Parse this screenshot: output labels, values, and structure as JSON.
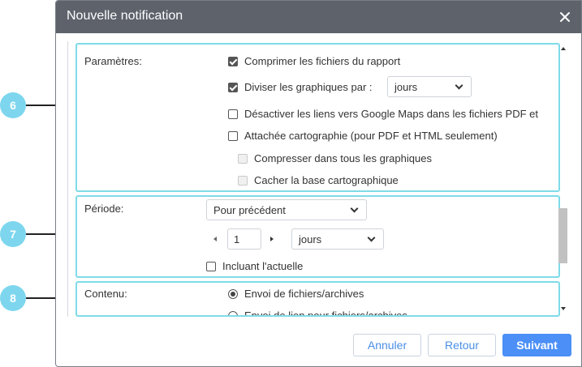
{
  "dialog": {
    "title": "Nouvelle notification",
    "close_icon": "close-icon"
  },
  "params": {
    "label": "Paramètres:",
    "compress": {
      "label": "Comprimer les fichiers du rapport",
      "checked": true
    },
    "split": {
      "label": "Diviser les graphiques par :",
      "checked": true,
      "select_value": "jours"
    },
    "disable_links": {
      "label": "Désactiver les liens vers Google Maps dans les fichiers PDF et",
      "checked": false
    },
    "attach_map": {
      "label": "Attachée cartographie (pour PDF et HTML seulement)",
      "checked": false
    },
    "compress_all": {
      "label": "Compresser dans tous les graphiques",
      "checked": false,
      "disabled": true
    },
    "hide_base": {
      "label": "Cacher la base cartographique",
      "checked": false,
      "disabled": true
    }
  },
  "period": {
    "label": "Période:",
    "type_value": "Pour précédent",
    "count": "1",
    "unit_value": "jours",
    "include_current": {
      "label": "Incluant l'actuelle",
      "checked": false
    }
  },
  "content": {
    "label": "Contenu:",
    "options": [
      {
        "label": "Envoi de fichiers/archives",
        "checked": true
      },
      {
        "label": "Envoi de lien pour fichiers/archives",
        "checked": false
      }
    ]
  },
  "callouts": [
    "6",
    "7",
    "8"
  ],
  "footer": {
    "cancel": "Annuler",
    "back": "Retour",
    "next": "Suivant"
  },
  "colors": {
    "header": "#5d626b",
    "section_border": "#7fdbe8",
    "callout": "#7dd6ee",
    "primary": "#4b8ff7"
  }
}
